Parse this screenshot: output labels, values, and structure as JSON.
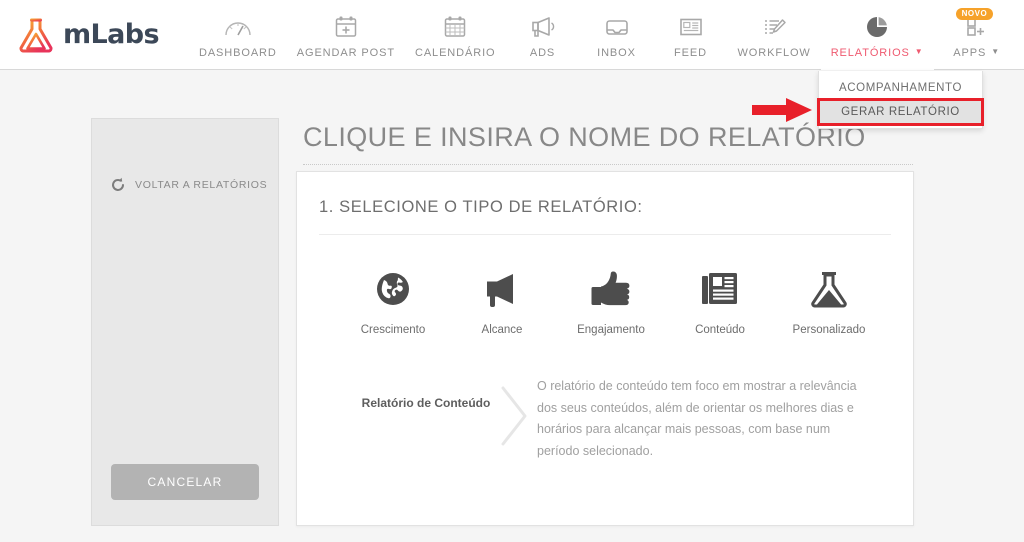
{
  "brand": {
    "name": "mLabs",
    "logo_icon": "flask-logo-icon"
  },
  "nav": {
    "items": [
      {
        "label": "DASHBOARD",
        "icon": "gauge-icon",
        "active": false,
        "caret": ""
      },
      {
        "label": "AGENDAR POST",
        "icon": "calendar-plus-icon",
        "active": false,
        "caret": ""
      },
      {
        "label": "CALENDÁRIO",
        "icon": "calendar-icon",
        "active": false,
        "caret": ""
      },
      {
        "label": "ADS",
        "icon": "megaphone-icon",
        "active": false,
        "caret": ""
      },
      {
        "label": "INBOX",
        "icon": "inbox-icon",
        "active": false,
        "caret": ""
      },
      {
        "label": "FEED",
        "icon": "newspaper-icon",
        "active": false,
        "caret": ""
      },
      {
        "label": "WORKFLOW",
        "icon": "list-pencil-icon",
        "active": false,
        "caret": ""
      },
      {
        "label": "RELATÓRIOS",
        "icon": "pie-chart-icon",
        "active": true,
        "caret": "▼"
      },
      {
        "label": "APPS",
        "icon": "apps-plus-icon",
        "active": false,
        "caret": "▼",
        "badge": "NOVO"
      }
    ]
  },
  "dropdown": {
    "items": [
      {
        "label": "ACOMPANHAMENTO",
        "highlighted": false
      },
      {
        "label": "GERAR RELATÓRIO",
        "highlighted": true
      }
    ]
  },
  "annotation": {
    "arrow_color": "#e8202a",
    "highlight_color": "#e8202a"
  },
  "sidebar": {
    "back_label": "VOLTAR A RELATÓRIOS",
    "back_icon": "refresh-arrow-icon",
    "cancel_label": "CANCELAR"
  },
  "main": {
    "title": "CLIQUE E INSIRA O NOME DO RELATÓRIO",
    "section_heading": "1. SELECIONE O TIPO DE RELATÓRIO:",
    "report_types": [
      {
        "label": "Crescimento",
        "icon": "globe-icon"
      },
      {
        "label": "Alcance",
        "icon": "megaphone-icon"
      },
      {
        "label": "Engajamento",
        "icon": "thumbs-up-icon"
      },
      {
        "label": "Conteúdo",
        "icon": "newspaper-icon"
      },
      {
        "label": "Personalizado",
        "icon": "flask-icon"
      }
    ],
    "description": {
      "name": "Relatório de Conteúdo",
      "chevron_icon": "chevron-right-icon",
      "text": "O relatório de conteúdo tem foco em mostrar a relevância dos seus conteúdos, além de orientar os melhores dias e horários para alcançar mais pessoas, com base num período selecionado."
    }
  },
  "colors": {
    "accent_red": "#ef5a70",
    "badge_orange": "#f6a22a",
    "annotation_red": "#e8202a",
    "page_bg": "#f5f5f5"
  }
}
